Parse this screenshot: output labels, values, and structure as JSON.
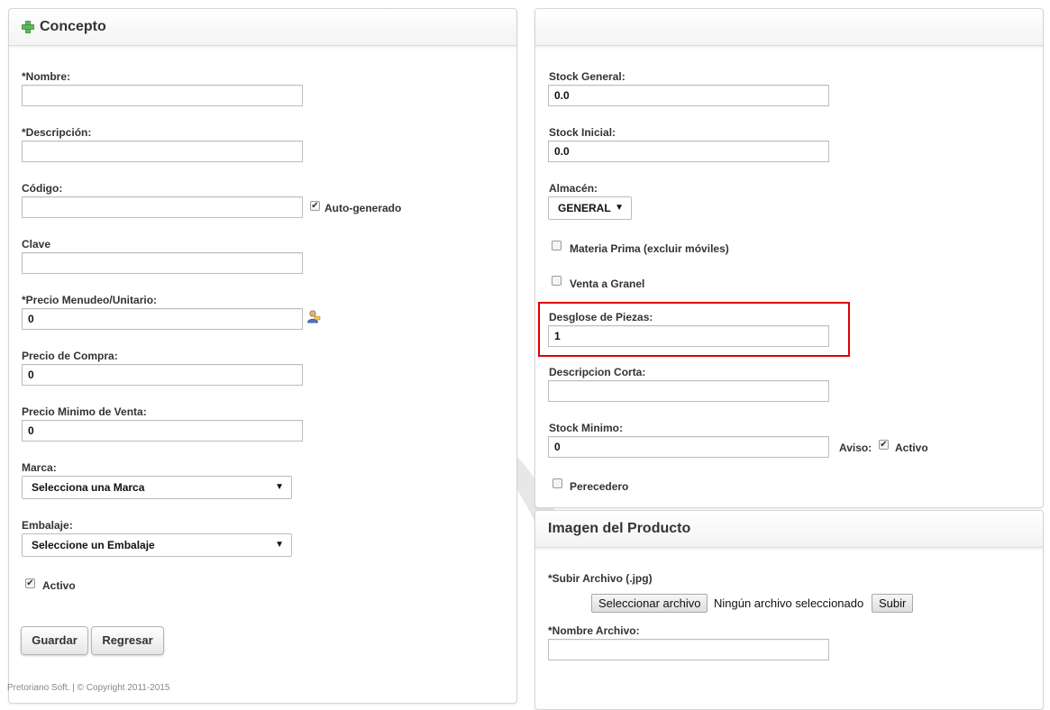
{
  "left_panel": {
    "title": "Concepto",
    "fields": {
      "nombre_label": "*Nombre:",
      "nombre_value": "",
      "descripcion_label": "*Descripción:",
      "descripcion_value": "",
      "codigo_label": "Código:",
      "codigo_value": "",
      "autogenerado_label": "Auto-generado",
      "autogenerado_checked": true,
      "clave_label": "Clave",
      "clave_value": "",
      "precio_menudeo_label": "*Precio Menudeo/Unitario:",
      "precio_menudeo_value": "0",
      "precio_compra_label": "Precio de Compra:",
      "precio_compra_value": "0",
      "precio_minimo_label": "Precio Minimo de Venta:",
      "precio_minimo_value": "0",
      "marca_label": "Marca:",
      "marca_value": "Selecciona una Marca",
      "embalaje_label": "Embalaje:",
      "embalaje_value": "Seleccione un Embalaje",
      "activo_label": "Activo",
      "activo_checked": true
    },
    "buttons": {
      "guardar": "Guardar",
      "regresar": "Regresar"
    },
    "footer": "Pretoriano Soft. | © Copyright 2011-2015"
  },
  "right_panel": {
    "title": "",
    "fields": {
      "stock_general_label": "Stock General:",
      "stock_general_value": "0.0",
      "stock_inicial_label": "Stock Inicial:",
      "stock_inicial_value": "0.0",
      "almacen_label": "Almacén:",
      "almacen_value": "GENERAL",
      "materia_prima_label": "Materia Prima (excluir móviles)",
      "materia_prima_checked": false,
      "venta_granel_label": "Venta a Granel",
      "venta_granel_checked": false,
      "desglose_label": "Desglose de Piezas:",
      "desglose_value": "1",
      "descripcion_corta_label": "Descripcion Corta:",
      "descripcion_corta_value": "",
      "stock_minimo_label": "Stock Minimo:",
      "stock_minimo_value": "0",
      "aviso_label": "Aviso:",
      "aviso_activo_label": "Activo",
      "aviso_checked": true,
      "perecedero_label": "Perecedero",
      "perecedero_checked": false
    },
    "highlight_color": "#e00000"
  },
  "image_panel": {
    "title": "Imagen del Producto",
    "subir_label": "*Subir Archivo (.jpg)",
    "select_file_button": "Seleccionar archivo",
    "no_file_text": "Ningún archivo seleccionado",
    "subir_button": "Subir",
    "nombre_archivo_label": "*Nombre Archivo:",
    "nombre_archivo_value": ""
  },
  "icons": {
    "header_icon": "puzzle-plus-icon",
    "price_icon": "user-price-icon"
  },
  "colors": {
    "header_icon_green": "#5cb85c"
  }
}
